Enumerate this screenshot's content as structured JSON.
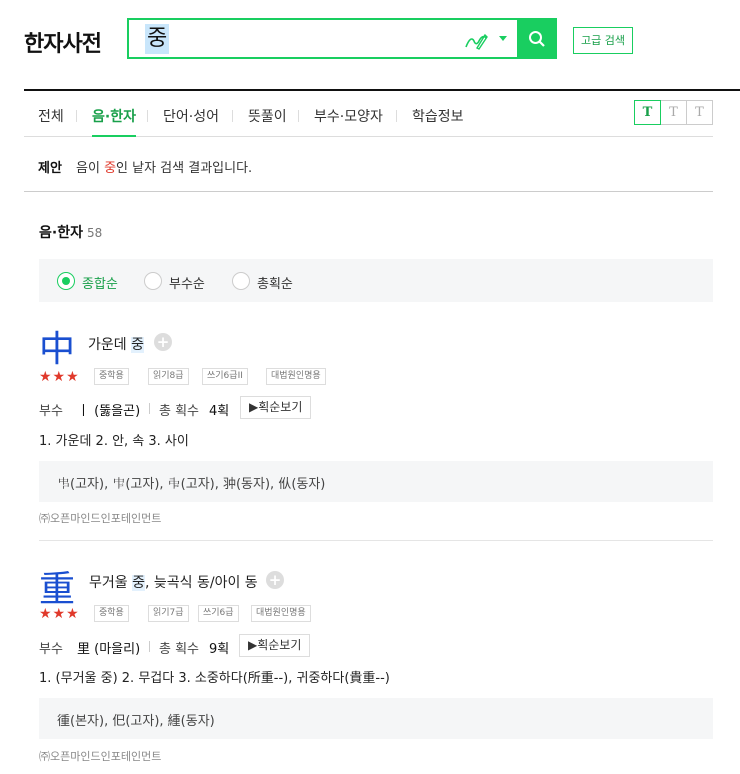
{
  "app": {
    "title": "한자사전"
  },
  "search": {
    "query": "중",
    "advanced_label": "고급 검색"
  },
  "tabs": [
    "전체",
    "음·한자",
    "단어·성어",
    "뜻풀이",
    "부수·모양자",
    "학습정보"
  ],
  "font_size_buttons": [
    "T",
    "T",
    "T"
  ],
  "suggestion": {
    "label": "제안",
    "pre": "음이 ",
    "highlight": "중",
    "post": "인 낱자 검색 결과입니다."
  },
  "section": {
    "title": "음·한자",
    "count": "58"
  },
  "sort_options": [
    "종합순",
    "부수순",
    "총획순"
  ],
  "entries": [
    {
      "hanja": "中",
      "meaning_pre": "가운데 ",
      "meaning_hl": "중",
      "meaning_post": "",
      "stars": "★★★",
      "badges": [
        "중학용",
        "읽기8급",
        "쓰기6급II",
        "대법원인명용"
      ],
      "radical_label": "부수",
      "radical_value": "丨 (뚫을곤)",
      "strokes_label": "총 획수",
      "strokes_value": "4획",
      "stroke_btn": "▶획순보기",
      "definitions": "1. 가운데  2. 안, 속  3. 사이",
      "variants": "𠁧(고자), 𠁦(고자), 𠁩(고자), 𠁨(동자), 㐺(동자)",
      "source": "㈜오픈마인드인포테인먼트"
    },
    {
      "hanja": "重",
      "meaning_pre": "무거울 ",
      "meaning_hl": "중",
      "meaning_post": ", 늦곡식 동/아이 동",
      "stars": "★★★",
      "badges": [
        "중학용",
        "읽기7급",
        "쓰기6급",
        "대법원인명용"
      ],
      "radical_label": "부수",
      "radical_value": "里 (마을리)",
      "strokes_label": "총 획수",
      "strokes_value": "9획",
      "stroke_btn": "▶획순보기",
      "definitions": "1. (무거울 중)  2. 무겁다  3. 소중하다(所重--), 귀중하다(貴重--)",
      "variants": "㣫(본자), 㐶(고자), 緟(동자)",
      "source": "㈜오픈마인드인포테인먼트"
    }
  ],
  "colors": {
    "accent": "#19ce60",
    "hanja": "#1a4fd0",
    "star": "#e0392b"
  }
}
